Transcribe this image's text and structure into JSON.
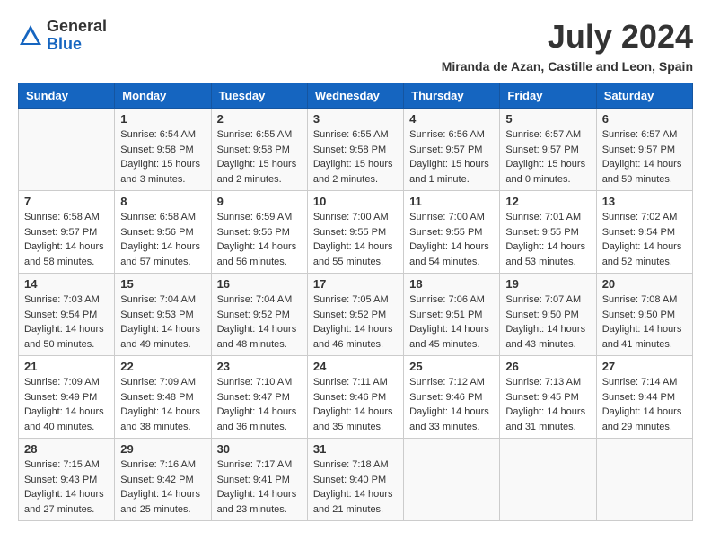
{
  "header": {
    "logo_general": "General",
    "logo_blue": "Blue",
    "month_title": "July 2024",
    "subtitle": "Miranda de Azan, Castille and Leon, Spain"
  },
  "weekdays": [
    "Sunday",
    "Monday",
    "Tuesday",
    "Wednesday",
    "Thursday",
    "Friday",
    "Saturday"
  ],
  "weeks": [
    [
      {
        "day": "",
        "sunrise": "",
        "sunset": "",
        "daylight": ""
      },
      {
        "day": "1",
        "sunrise": "Sunrise: 6:54 AM",
        "sunset": "Sunset: 9:58 PM",
        "daylight": "Daylight: 15 hours and 3 minutes."
      },
      {
        "day": "2",
        "sunrise": "Sunrise: 6:55 AM",
        "sunset": "Sunset: 9:58 PM",
        "daylight": "Daylight: 15 hours and 2 minutes."
      },
      {
        "day": "3",
        "sunrise": "Sunrise: 6:55 AM",
        "sunset": "Sunset: 9:58 PM",
        "daylight": "Daylight: 15 hours and 2 minutes."
      },
      {
        "day": "4",
        "sunrise": "Sunrise: 6:56 AM",
        "sunset": "Sunset: 9:57 PM",
        "daylight": "Daylight: 15 hours and 1 minute."
      },
      {
        "day": "5",
        "sunrise": "Sunrise: 6:57 AM",
        "sunset": "Sunset: 9:57 PM",
        "daylight": "Daylight: 15 hours and 0 minutes."
      },
      {
        "day": "6",
        "sunrise": "Sunrise: 6:57 AM",
        "sunset": "Sunset: 9:57 PM",
        "daylight": "Daylight: 14 hours and 59 minutes."
      }
    ],
    [
      {
        "day": "7",
        "sunrise": "Sunrise: 6:58 AM",
        "sunset": "Sunset: 9:57 PM",
        "daylight": "Daylight: 14 hours and 58 minutes."
      },
      {
        "day": "8",
        "sunrise": "Sunrise: 6:58 AM",
        "sunset": "Sunset: 9:56 PM",
        "daylight": "Daylight: 14 hours and 57 minutes."
      },
      {
        "day": "9",
        "sunrise": "Sunrise: 6:59 AM",
        "sunset": "Sunset: 9:56 PM",
        "daylight": "Daylight: 14 hours and 56 minutes."
      },
      {
        "day": "10",
        "sunrise": "Sunrise: 7:00 AM",
        "sunset": "Sunset: 9:55 PM",
        "daylight": "Daylight: 14 hours and 55 minutes."
      },
      {
        "day": "11",
        "sunrise": "Sunrise: 7:00 AM",
        "sunset": "Sunset: 9:55 PM",
        "daylight": "Daylight: 14 hours and 54 minutes."
      },
      {
        "day": "12",
        "sunrise": "Sunrise: 7:01 AM",
        "sunset": "Sunset: 9:55 PM",
        "daylight": "Daylight: 14 hours and 53 minutes."
      },
      {
        "day": "13",
        "sunrise": "Sunrise: 7:02 AM",
        "sunset": "Sunset: 9:54 PM",
        "daylight": "Daylight: 14 hours and 52 minutes."
      }
    ],
    [
      {
        "day": "14",
        "sunrise": "Sunrise: 7:03 AM",
        "sunset": "Sunset: 9:54 PM",
        "daylight": "Daylight: 14 hours and 50 minutes."
      },
      {
        "day": "15",
        "sunrise": "Sunrise: 7:04 AM",
        "sunset": "Sunset: 9:53 PM",
        "daylight": "Daylight: 14 hours and 49 minutes."
      },
      {
        "day": "16",
        "sunrise": "Sunrise: 7:04 AM",
        "sunset": "Sunset: 9:52 PM",
        "daylight": "Daylight: 14 hours and 48 minutes."
      },
      {
        "day": "17",
        "sunrise": "Sunrise: 7:05 AM",
        "sunset": "Sunset: 9:52 PM",
        "daylight": "Daylight: 14 hours and 46 minutes."
      },
      {
        "day": "18",
        "sunrise": "Sunrise: 7:06 AM",
        "sunset": "Sunset: 9:51 PM",
        "daylight": "Daylight: 14 hours and 45 minutes."
      },
      {
        "day": "19",
        "sunrise": "Sunrise: 7:07 AM",
        "sunset": "Sunset: 9:50 PM",
        "daylight": "Daylight: 14 hours and 43 minutes."
      },
      {
        "day": "20",
        "sunrise": "Sunrise: 7:08 AM",
        "sunset": "Sunset: 9:50 PM",
        "daylight": "Daylight: 14 hours and 41 minutes."
      }
    ],
    [
      {
        "day": "21",
        "sunrise": "Sunrise: 7:09 AM",
        "sunset": "Sunset: 9:49 PM",
        "daylight": "Daylight: 14 hours and 40 minutes."
      },
      {
        "day": "22",
        "sunrise": "Sunrise: 7:09 AM",
        "sunset": "Sunset: 9:48 PM",
        "daylight": "Daylight: 14 hours and 38 minutes."
      },
      {
        "day": "23",
        "sunrise": "Sunrise: 7:10 AM",
        "sunset": "Sunset: 9:47 PM",
        "daylight": "Daylight: 14 hours and 36 minutes."
      },
      {
        "day": "24",
        "sunrise": "Sunrise: 7:11 AM",
        "sunset": "Sunset: 9:46 PM",
        "daylight": "Daylight: 14 hours and 35 minutes."
      },
      {
        "day": "25",
        "sunrise": "Sunrise: 7:12 AM",
        "sunset": "Sunset: 9:46 PM",
        "daylight": "Daylight: 14 hours and 33 minutes."
      },
      {
        "day": "26",
        "sunrise": "Sunrise: 7:13 AM",
        "sunset": "Sunset: 9:45 PM",
        "daylight": "Daylight: 14 hours and 31 minutes."
      },
      {
        "day": "27",
        "sunrise": "Sunrise: 7:14 AM",
        "sunset": "Sunset: 9:44 PM",
        "daylight": "Daylight: 14 hours and 29 minutes."
      }
    ],
    [
      {
        "day": "28",
        "sunrise": "Sunrise: 7:15 AM",
        "sunset": "Sunset: 9:43 PM",
        "daylight": "Daylight: 14 hours and 27 minutes."
      },
      {
        "day": "29",
        "sunrise": "Sunrise: 7:16 AM",
        "sunset": "Sunset: 9:42 PM",
        "daylight": "Daylight: 14 hours and 25 minutes."
      },
      {
        "day": "30",
        "sunrise": "Sunrise: 7:17 AM",
        "sunset": "Sunset: 9:41 PM",
        "daylight": "Daylight: 14 hours and 23 minutes."
      },
      {
        "day": "31",
        "sunrise": "Sunrise: 7:18 AM",
        "sunset": "Sunset: 9:40 PM",
        "daylight": "Daylight: 14 hours and 21 minutes."
      },
      {
        "day": "",
        "sunrise": "",
        "sunset": "",
        "daylight": ""
      },
      {
        "day": "",
        "sunrise": "",
        "sunset": "",
        "daylight": ""
      },
      {
        "day": "",
        "sunrise": "",
        "sunset": "",
        "daylight": ""
      }
    ]
  ]
}
